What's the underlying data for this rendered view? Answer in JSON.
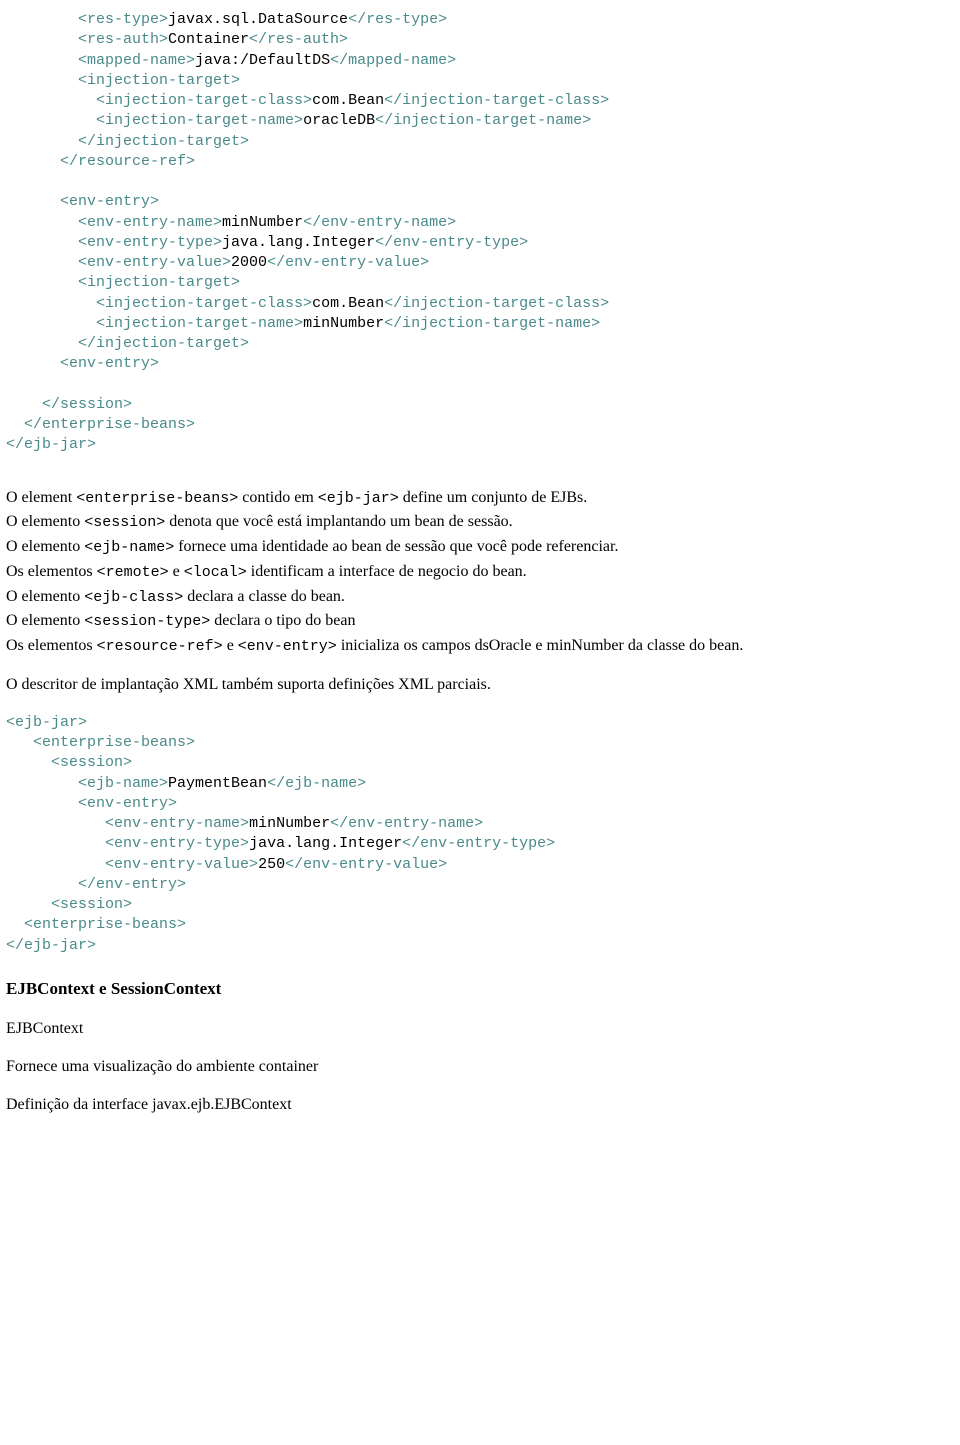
{
  "code1": {
    "l1": {
      "i": "        ",
      "a": "<res-type>",
      "t": "javax.sql.DataSource",
      "b": "</res-type>"
    },
    "l2": {
      "i": "        ",
      "a": "<res-auth>",
      "t": "Container",
      "b": "</res-auth>"
    },
    "l3": {
      "i": "        ",
      "a": "<mapped-name>",
      "t": "java:/DefaultDS",
      "b": "</mapped-name>"
    },
    "l4": {
      "i": "        ",
      "a": "<injection-target>"
    },
    "l5": {
      "i": "          ",
      "a": "<injection-target-class>",
      "t": "com.Bean",
      "b": "</injection-target-class>"
    },
    "l6": {
      "i": "          ",
      "a": "<injection-target-name>",
      "t": "oracleDB",
      "b": "</injection-target-name>"
    },
    "l7": {
      "i": "        ",
      "a": "</injection-target>"
    },
    "l8": {
      "i": "      ",
      "a": "</resource-ref>"
    },
    "l9": {
      "i": "      ",
      "a": "<env-entry>"
    },
    "l10": {
      "i": "        ",
      "a": "<env-entry-name>",
      "t": "minNumber",
      "b": "</env-entry-name>"
    },
    "l11": {
      "i": "        ",
      "a": "<env-entry-type>",
      "t": "java.lang.Integer",
      "b": "</env-entry-type>"
    },
    "l12": {
      "i": "        ",
      "a": "<env-entry-value>",
      "t": "2000",
      "b": "</env-entry-value>"
    },
    "l13": {
      "i": "        ",
      "a": "<injection-target>"
    },
    "l14": {
      "i": "          ",
      "a": "<injection-target-class>",
      "t": "com.Bean",
      "b": "</injection-target-class>"
    },
    "l15": {
      "i": "          ",
      "a": "<injection-target-name>",
      "t": "minNumber",
      "b": "</injection-target-name>"
    },
    "l16": {
      "i": "        ",
      "a": "</injection-target>"
    },
    "l17": {
      "i": "      ",
      "a": "<env-entry>"
    },
    "l18": {
      "i": "    ",
      "a": "</session>"
    },
    "l19": {
      "i": "  ",
      "a": "</enterprise-beans>"
    },
    "l20": {
      "i": "",
      "a": "</ejb-jar>"
    }
  },
  "para": {
    "line1": {
      "pre": "O element ",
      "c1": "<enterprise-beans>",
      "mid": " contido em  ",
      "c2": "<ejb-jar>",
      "post": "  define um conjunto de EJBs."
    },
    "line2": {
      "pre": "O elemento ",
      "c1": "<session>",
      "post": "  denota que você está implantando um bean de sessão."
    },
    "line3": {
      "pre": "O elemento ",
      "c1": "<ejb-name>",
      "post": " fornece uma identidade ao bean de sessão que você pode referenciar."
    },
    "line4": {
      "pre": "Os elementos ",
      "c1": "<remote>",
      "mid": " e ",
      "c2": "<local>",
      "post": " identificam a interface de negocio do bean."
    },
    "line5": {
      "pre": "O elemento  ",
      "c1": "<ejb-class>",
      "post": "  declara a classe do bean."
    },
    "line6": {
      "pre": "O elemento  ",
      "c1": "<session-type>",
      "post": "  declara o tipo do bean"
    },
    "line7": {
      "pre": "Os elementos ",
      "c1": "<resource-ref>",
      "mid": " e ",
      "c2": "<env-entry>",
      "post": "  inicializa os campos dsOracle e minNumber da classe do bean."
    },
    "line8": "O descritor de implantação XML também suporta definições XML parciais."
  },
  "code2": {
    "l1": {
      "i": "",
      "a": "<ejb-jar>"
    },
    "l2": {
      "i": "   ",
      "a": "<enterprise-beans>"
    },
    "l3": {
      "i": "     ",
      "a": "<session>"
    },
    "l4": {
      "i": "        ",
      "a": "<ejb-name>",
      "t": "PaymentBean",
      "b": "</ejb-name>"
    },
    "l5": {
      "i": "        ",
      "a": "<env-entry>"
    },
    "l6": {
      "i": "           ",
      "a": "<env-entry-name>",
      "t": "minNumber",
      "b": "</env-entry-name>"
    },
    "l7": {
      "i": "           ",
      "a": "<env-entry-type>",
      "t": "java.lang.Integer",
      "b": "</env-entry-type>"
    },
    "l8": {
      "i": "           ",
      "a": "<env-entry-value>",
      "t": "250",
      "b": "</env-entry-value>"
    },
    "l9": {
      "i": "        ",
      "a": "</env-entry>"
    },
    "l10": {
      "i": "     ",
      "a": "<session>"
    },
    "l11": {
      "i": "  ",
      "a": "<enterprise-beans>"
    },
    "l12": {
      "i": "",
      "a": "</ejb-jar>"
    }
  },
  "headings": {
    "h1": "EJBContext e SessionContext",
    "sub": "EJBContext",
    "p1": "Fornece uma visualização do ambiente container",
    "p2": "Definição da interface javax.ejb.EJBContext"
  }
}
